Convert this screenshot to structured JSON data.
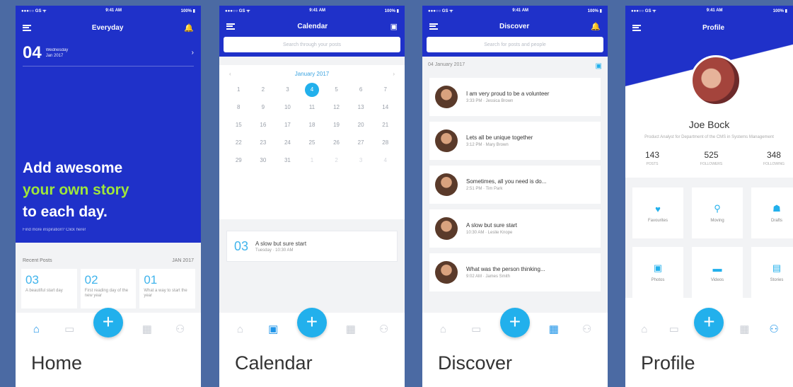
{
  "status": {
    "carrier": "●●●○○ GS ᯤ",
    "time": "9:41 AM",
    "battery": "100% ▮"
  },
  "home": {
    "title": "Everyday",
    "day": "04",
    "weekday": "Wednesday",
    "monthyear": "Jan 2017",
    "headline1": "Add awesome",
    "headline2": "your own story",
    "headline3": "to each day.",
    "link": "Find more inspiration? Click here!",
    "recent_label": "Recent Posts",
    "recent_date": "JAN 2017",
    "cards": [
      {
        "n": "03",
        "s": "A beautiful start day"
      },
      {
        "n": "02",
        "s": "First reading day of the new year"
      },
      {
        "n": "01",
        "s": "What a way to start the year"
      }
    ],
    "caption": "Home"
  },
  "calendar": {
    "title": "Calendar",
    "search_placeholder": "Search through your posts",
    "month": "January 2017",
    "days": [
      "1",
      "2",
      "3",
      "4",
      "5",
      "6",
      "7",
      "8",
      "9",
      "10",
      "11",
      "12",
      "13",
      "14",
      "15",
      "16",
      "17",
      "18",
      "19",
      "20",
      "21",
      "22",
      "23",
      "24",
      "25",
      "26",
      "27",
      "28",
      "29",
      "30",
      "31",
      "1",
      "2",
      "3",
      "4"
    ],
    "today_index": 3,
    "event_num": "03",
    "event_title": "A slow but sure start",
    "event_sub": "Tuesday · 10:30 AM",
    "caption": "Calendar"
  },
  "discover": {
    "title": "Discover",
    "search_placeholder": "Search for posts and people",
    "date": "04 January 2017",
    "posts": [
      {
        "t": "I am very proud to be a volunteer",
        "s": "3:33 PM · Jessica Brown"
      },
      {
        "t": "Lets all be unique together",
        "s": "3:12 PM · Mary Brown"
      },
      {
        "t": "Sometimes, all you need is do...",
        "s": "2:51 PM · Tim Park"
      },
      {
        "t": "A slow but sure start",
        "s": "10:30 AM · Leslie Knope"
      },
      {
        "t": "What was the person thinking...",
        "s": "9:02 AM · James Smith"
      }
    ],
    "caption": "Discover"
  },
  "profile": {
    "title": "Profile",
    "name": "Joe Bock",
    "bio": "Product Analyst for Department of the CMS in Systems Management",
    "stats": [
      {
        "v": "143",
        "l": "POSTS"
      },
      {
        "v": "525",
        "l": "FOLLOWERS"
      },
      {
        "v": "348",
        "l": "FOLLOWING"
      }
    ],
    "tiles": [
      {
        "i": "♥",
        "l": "Favourites"
      },
      {
        "i": "⚲",
        "l": "Moving"
      },
      {
        "i": "☗",
        "l": "Drafts"
      },
      {
        "i": "▣",
        "l": "Photos"
      },
      {
        "i": "▬",
        "l": "Videos"
      },
      {
        "i": "▤",
        "l": "Stories"
      }
    ],
    "caption": "Profile"
  },
  "colors": {
    "primary": "#1f31c9",
    "accent": "#22b0ec",
    "highlight": "#9ee63b"
  }
}
